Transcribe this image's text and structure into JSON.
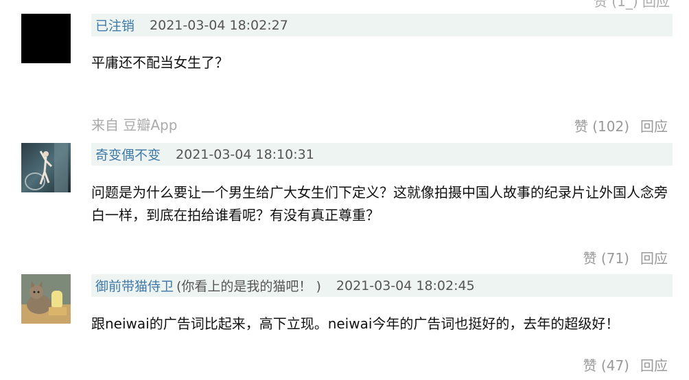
{
  "top_cut_text": "赞 (1_) 回应",
  "comments": [
    {
      "username": "已注销",
      "note": "",
      "timestamp": "2021-03-04 18:02:27",
      "text": "平庸还不配当女生了？",
      "source": "来自 豆瓣App",
      "likes": "赞 (102)",
      "reply": "回应",
      "avatar": "black-avatar"
    },
    {
      "username": "奇变偶不变",
      "note": "",
      "timestamp": "2021-03-04 18:10:31",
      "text": "问题是为什么要让一个男生给广大女生们下定义？这就像拍摄中国人故事的纪录片让外国人念旁白一样，到底在拍给谁看呢？有没有真正尊重？",
      "source": "",
      "likes": "赞 (71)",
      "reply": "回应",
      "avatar": "dancer-photo-avatar"
    },
    {
      "username": "御前带猫侍卫",
      "note": "(你看上的是我的猫吧！ )",
      "timestamp": "2021-03-04 18:02:45",
      "text": "跟neiwai的广告词比起来，高下立现。neiwai今年的广告词也挺好的，去年的超级好！",
      "source": "",
      "likes": "赞 (47)",
      "reply": "回应",
      "avatar": "cat-photo-avatar"
    }
  ],
  "colors": {
    "username": "#3e79a8",
    "header_bg": "#eef4f1",
    "muted": "#999999"
  }
}
